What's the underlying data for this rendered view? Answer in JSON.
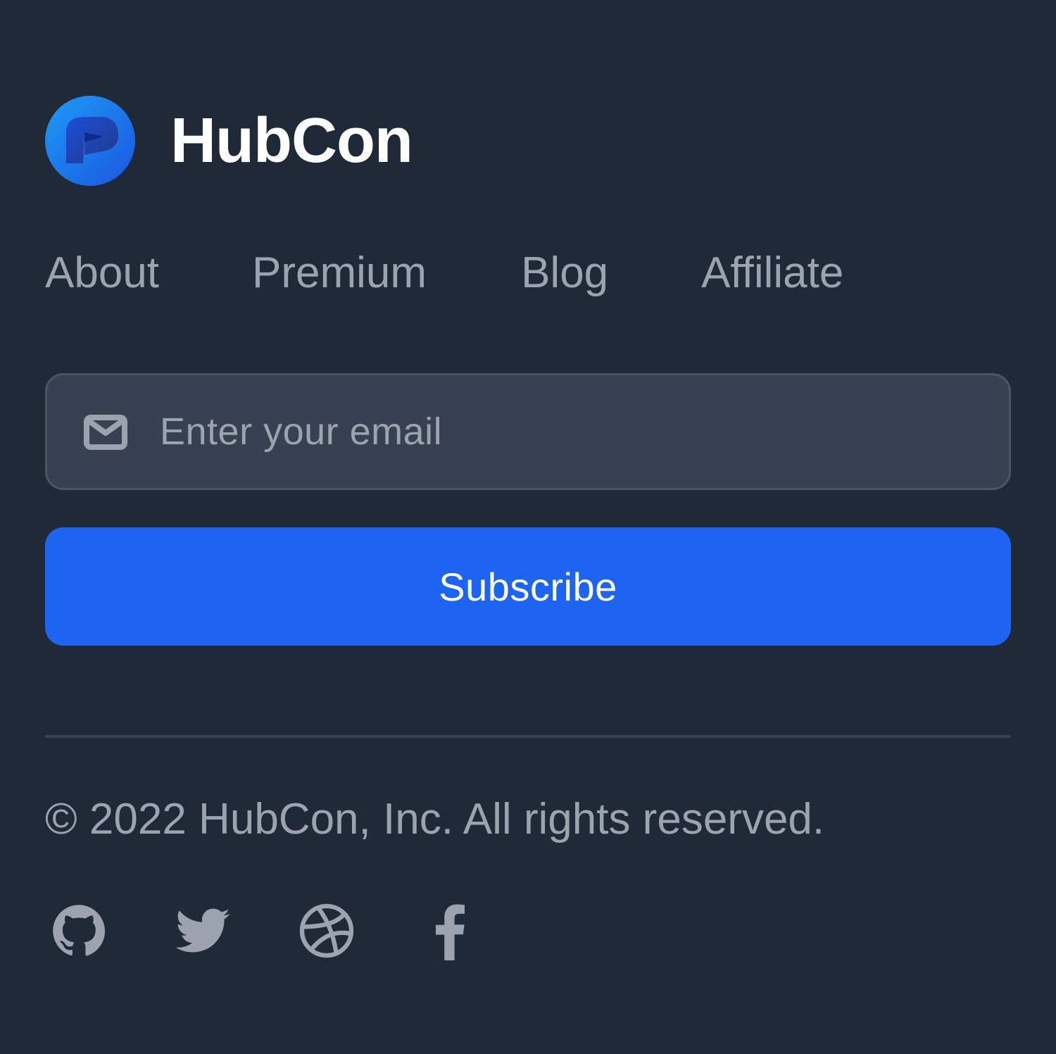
{
  "brand": {
    "name": "HubCon",
    "logo_icon": "hubcon-logo-icon",
    "logo_colors": [
      "#1e88f5",
      "#1d4ed8",
      "#2563eb"
    ]
  },
  "nav": {
    "items": [
      {
        "label": "About"
      },
      {
        "label": "Premium"
      },
      {
        "label": "Blog"
      },
      {
        "label": "Affiliate"
      }
    ]
  },
  "newsletter": {
    "email_icon": "mail-icon",
    "email_placeholder": "Enter your email",
    "email_value": "",
    "subscribe_label": "Subscribe"
  },
  "footer": {
    "copyright": "© 2022 HubCon, Inc. All rights reserved.",
    "social_icons": [
      "github-icon",
      "twitter-icon",
      "dribbble-icon",
      "facebook-icon"
    ]
  },
  "colors": {
    "background": "#1f2937",
    "accent": "#1d64f2",
    "muted_text": "#9ca3af",
    "input_background": "#374151",
    "input_border": "#4b5563"
  }
}
